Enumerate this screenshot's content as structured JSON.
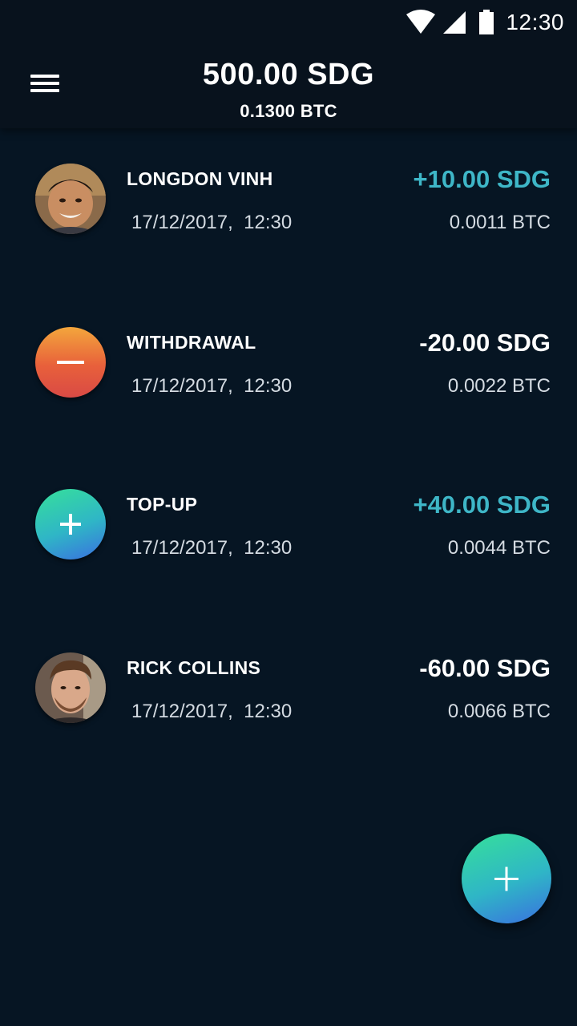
{
  "status_bar": {
    "time": "12:30",
    "icons": [
      "wifi-icon",
      "signal-icon",
      "battery-icon"
    ]
  },
  "header": {
    "menu_icon": "hamburger-menu-icon",
    "balance_fiat": "500.00 SDG",
    "balance_btc": "0.1300 BTC"
  },
  "transactions": [
    {
      "name": "LONGDON VINH",
      "date": "17/12/2017,  12:30",
      "amount": "+10.00 SDG",
      "btc": "0.0011 BTC",
      "type": "received",
      "avatar": "person-avatar"
    },
    {
      "name": "WITHDRAWAL",
      "date": "17/12/2017,  12:30",
      "amount": "-20.00 SDG",
      "btc": "0.0022 BTC",
      "type": "withdrawal",
      "avatar": "minus-icon"
    },
    {
      "name": "TOP-UP",
      "date": "17/12/2017,  12:30",
      "amount": "+40.00 SDG",
      "btc": "0.0044 BTC",
      "type": "topup",
      "avatar": "plus-icon"
    },
    {
      "name": "RICK COLLINS",
      "date": "17/12/2017,  12:30",
      "amount": "-60.00 SDG",
      "btc": "0.0066 BTC",
      "type": "sent",
      "avatar": "person-avatar"
    }
  ],
  "fab": {
    "icon": "plus-icon"
  },
  "colors": {
    "background": "#061523",
    "appbar": "#08121d",
    "positive_amount": "#3eb6c7",
    "negative_amount": "#ffffff",
    "withdraw_gradient": [
      "#f3a63c",
      "#d94a45"
    ],
    "topup_gradient": [
      "#36e09a",
      "#3a6fe0"
    ]
  }
}
